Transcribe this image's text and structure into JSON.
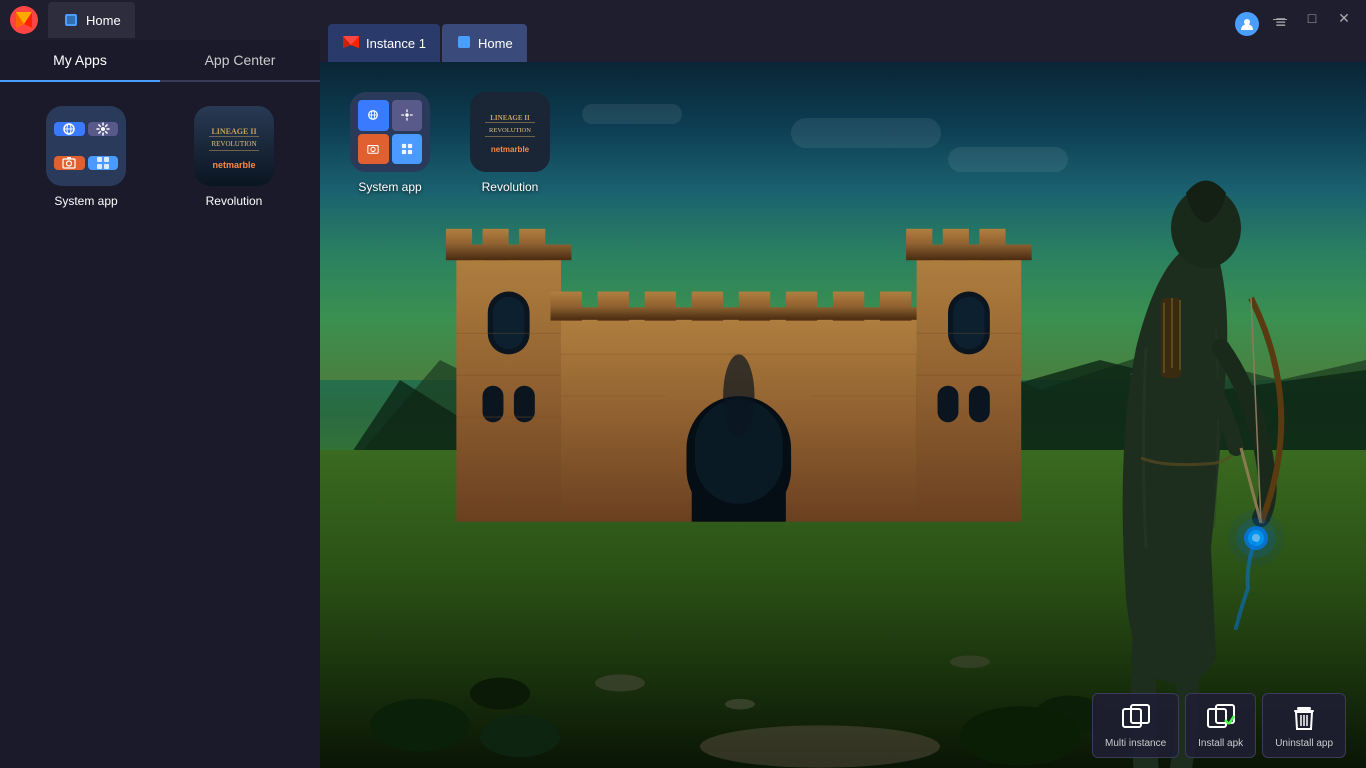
{
  "app": {
    "name": "BlueStacks",
    "title": "BlueStacks"
  },
  "main_window": {
    "home_tab": "Home"
  },
  "sidebar": {
    "my_apps_tab": "My Apps",
    "app_center_tab": "App Center",
    "apps": [
      {
        "name": "system-app",
        "label": "System app"
      },
      {
        "name": "revolution",
        "label": "Revolution"
      }
    ]
  },
  "instance_window": {
    "instance_tab": "Instance 1",
    "home_tab": "Home"
  },
  "game_apps": [
    {
      "label": "System app"
    },
    {
      "label": "Revolution"
    }
  ],
  "toolbar": {
    "multi_instance": "Multi instance",
    "install_apk": "Install apk",
    "uninstall_app": "Uninstall app"
  },
  "window_controls": {
    "minimize": "—",
    "maximize": "□",
    "close": "✕"
  }
}
